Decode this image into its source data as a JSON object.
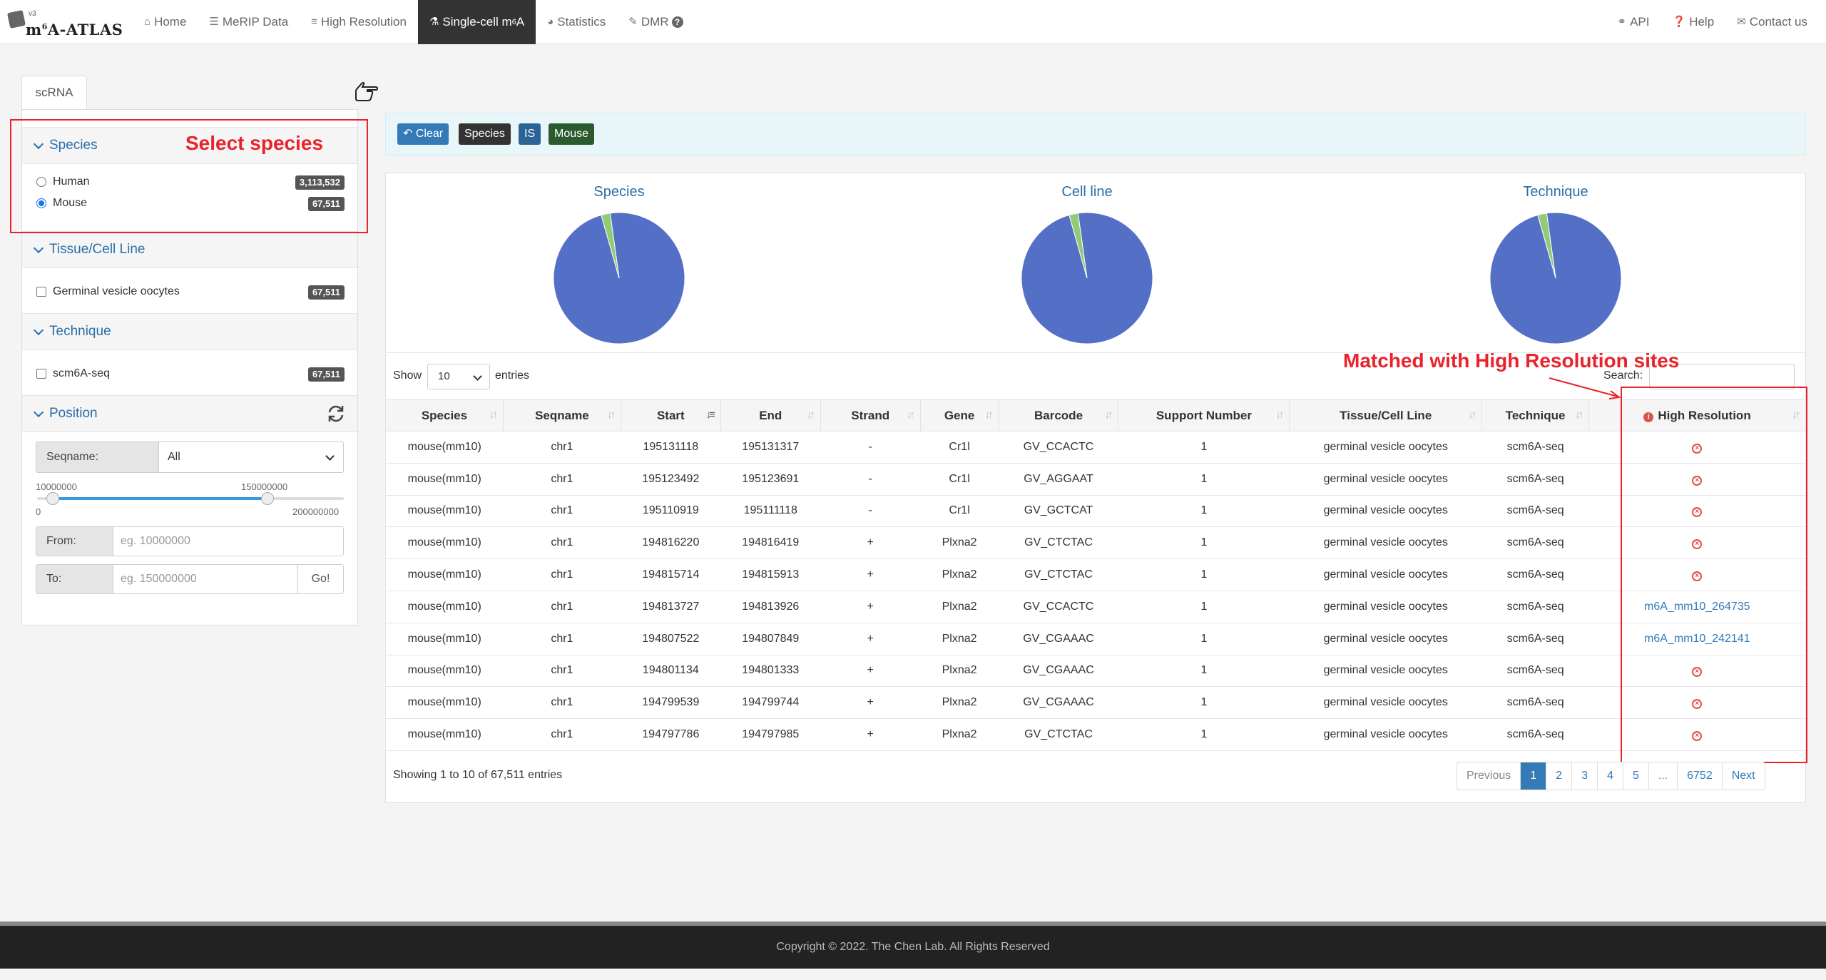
{
  "brand": {
    "version": "v3",
    "name_prefix": "m",
    "name_sup": "6",
    "name_suffix": "A-ATLAS"
  },
  "nav": {
    "home": "Home",
    "merip": "MeRIP Data",
    "high_res": "High Resolution",
    "single_cell_prefix": "Single-cell m",
    "single_cell_sup": "6",
    "single_cell_suffix": "A",
    "statistics": "Statistics",
    "dmr": "DMR",
    "dmr_help": "?",
    "api": "API",
    "help": "Help",
    "contact": "Contact us"
  },
  "sidebar": {
    "tab": "scRNA",
    "species": {
      "title": "Species",
      "options": [
        {
          "label": "Human",
          "count": "3,113,532",
          "selected": false
        },
        {
          "label": "Mouse",
          "count": "67,511",
          "selected": true
        }
      ]
    },
    "tissue": {
      "title": "Tissue/Cell Line",
      "options": [
        {
          "label": "Germinal vesicle oocytes",
          "count": "67,511"
        }
      ]
    },
    "technique": {
      "title": "Technique",
      "options": [
        {
          "label": "scm6A-seq",
          "count": "67,511"
        }
      ]
    },
    "position": {
      "title": "Position",
      "seqname_label": "Seqname:",
      "seqname_value": "All",
      "slider_low_label": "10000000",
      "slider_high_label": "150000000",
      "slider_min": "0",
      "slider_max": "200000000",
      "slider_low_value": 10000000,
      "slider_high_value": 150000000,
      "slider_range": [
        0,
        200000000
      ],
      "from_label": "From:",
      "from_placeholder": "eg. 10000000",
      "to_label": "To:",
      "to_placeholder": "eg. 150000000",
      "go_label": "Go!"
    }
  },
  "annotations": {
    "select_species": "Select species",
    "matched": "Matched with High Resolution sites"
  },
  "filters": {
    "clear": "Clear",
    "tags": [
      "Species",
      "IS",
      "Mouse"
    ]
  },
  "charts": [
    {
      "title": "Species"
    },
    {
      "title": "Cell line"
    },
    {
      "title": "Technique"
    }
  ],
  "chart_data": [
    {
      "type": "pie",
      "title": "Species",
      "values": [
        97.8,
        2.2
      ],
      "colors": [
        "#5470c6",
        "#91cc75"
      ]
    },
    {
      "type": "pie",
      "title": "Cell line",
      "values": [
        97.8,
        2.2
      ],
      "colors": [
        "#5470c6",
        "#91cc75"
      ]
    },
    {
      "type": "pie",
      "title": "Technique",
      "values": [
        97.8,
        2.2
      ],
      "colors": [
        "#5470c6",
        "#91cc75"
      ]
    }
  ],
  "table": {
    "show_label": "Show",
    "page_size": "10",
    "entries_label": "entries",
    "search_label": "Search:",
    "columns": [
      "Species",
      "Seqname",
      "Start",
      "End",
      "Strand",
      "Gene",
      "Barcode",
      "Support Number",
      "Tissue/Cell Line",
      "Technique",
      "High Resolution"
    ],
    "rows": [
      [
        "mouse(mm10)",
        "chr1",
        "195131118",
        "195131317",
        "-",
        "Cr1l",
        "GV_CCACTC",
        "1",
        "germinal vesicle oocytes",
        "scm6A-seq",
        ""
      ],
      [
        "mouse(mm10)",
        "chr1",
        "195123492",
        "195123691",
        "-",
        "Cr1l",
        "GV_AGGAAT",
        "1",
        "germinal vesicle oocytes",
        "scm6A-seq",
        ""
      ],
      [
        "mouse(mm10)",
        "chr1",
        "195110919",
        "195111118",
        "-",
        "Cr1l",
        "GV_GCTCAT",
        "1",
        "germinal vesicle oocytes",
        "scm6A-seq",
        ""
      ],
      [
        "mouse(mm10)",
        "chr1",
        "194816220",
        "194816419",
        "+",
        "Plxna2",
        "GV_CTCTAC",
        "1",
        "germinal vesicle oocytes",
        "scm6A-seq",
        ""
      ],
      [
        "mouse(mm10)",
        "chr1",
        "194815714",
        "194815913",
        "+",
        "Plxna2",
        "GV_CTCTAC",
        "1",
        "germinal vesicle oocytes",
        "scm6A-seq",
        ""
      ],
      [
        "mouse(mm10)",
        "chr1",
        "194813727",
        "194813926",
        "+",
        "Plxna2",
        "GV_CCACTC",
        "1",
        "germinal vesicle oocytes",
        "scm6A-seq",
        "m6A_mm10_264735"
      ],
      [
        "mouse(mm10)",
        "chr1",
        "194807522",
        "194807849",
        "+",
        "Plxna2",
        "GV_CGAAAC",
        "1",
        "germinal vesicle oocytes",
        "scm6A-seq",
        "m6A_mm10_242141"
      ],
      [
        "mouse(mm10)",
        "chr1",
        "194801134",
        "194801333",
        "+",
        "Plxna2",
        "GV_CGAAAC",
        "1",
        "germinal vesicle oocytes",
        "scm6A-seq",
        ""
      ],
      [
        "mouse(mm10)",
        "chr1",
        "194799539",
        "194799744",
        "+",
        "Plxna2",
        "GV_CGAAAC",
        "1",
        "germinal vesicle oocytes",
        "scm6A-seq",
        ""
      ],
      [
        "mouse(mm10)",
        "chr1",
        "194797786",
        "194797985",
        "+",
        "Plxna2",
        "GV_CTCTAC",
        "1",
        "germinal vesicle oocytes",
        "scm6A-seq",
        ""
      ]
    ],
    "info": "Showing 1 to 10 of 67,511 entries",
    "pagination": [
      "Previous",
      "1",
      "2",
      "3",
      "4",
      "5",
      "...",
      "6752",
      "Next"
    ],
    "active_page": "1"
  },
  "footer": {
    "text": "Copyright © 2022. The Chen Lab. All Rights Reserved"
  }
}
